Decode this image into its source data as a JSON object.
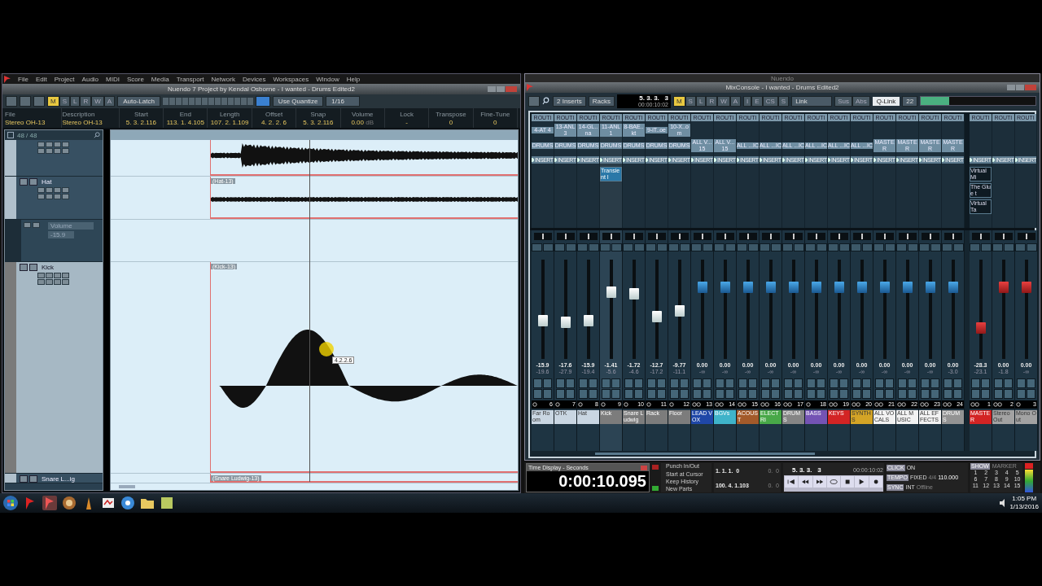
{
  "left_window": {
    "menu": [
      "File",
      "Edit",
      "Project",
      "Audio",
      "MIDI",
      "Score",
      "Media",
      "Transport",
      "Network",
      "Devices",
      "Workspaces",
      "Window",
      "Help"
    ],
    "title": "Nuendo 7 Project by Kendal Osborne - I wanted - Drums Edited2",
    "toolbar": {
      "modes": [
        {
          "label": "M",
          "on": true
        },
        {
          "label": "S",
          "on": false
        },
        {
          "label": "L",
          "on": false
        },
        {
          "label": "R",
          "on": false
        },
        {
          "label": "W",
          "on": false
        },
        {
          "label": "A",
          "on": false
        }
      ],
      "automation_mode": "Auto-Latch",
      "quantize": "Use Quantize",
      "grid": "1/16"
    },
    "info_line": [
      {
        "label": "File",
        "value": "Stereo OH-13"
      },
      {
        "label": "Description",
        "value": "Stereo OH-13"
      },
      {
        "label": "Start",
        "value": "5. 3. 2.116"
      },
      {
        "label": "End",
        "value": "113. 1. 4.105"
      },
      {
        "label": "Length",
        "value": "107. 2. 1.109"
      },
      {
        "label": "Offset",
        "value": "4. 2. 2.  6"
      },
      {
        "label": "Snap",
        "value": "5. 3. 2.116"
      },
      {
        "label": "Volume",
        "value": "0.00",
        "unit": "dB"
      },
      {
        "label": "Lock",
        "value": "-"
      },
      {
        "label": "Transpose",
        "value": "0"
      },
      {
        "label": "Fine-Tune",
        "value": "0"
      }
    ],
    "track_count": "48 / 48",
    "tracks": [
      {
        "kind": "track",
        "selected": false
      },
      {
        "kind": "track",
        "name": "Hat",
        "selected": false,
        "event": "(Hat-13)"
      },
      {
        "kind": "automation",
        "parameter": "Volume",
        "value": "-15.9"
      },
      {
        "kind": "track",
        "name": "Kick",
        "selected": true,
        "event": "(Kick-13)"
      },
      {
        "kind": "track",
        "name": "Snare L...ig",
        "selected": false,
        "event": "(Snare Ludwig-13)"
      }
    ],
    "tooltip": "4.2.2.6"
  },
  "mixer": {
    "app_title": "Nuendo",
    "title": "MixConsole - I wanted - Drums Edited2",
    "toolbar": {
      "inserts": "2 Inserts",
      "racks": "Racks",
      "position": "5. 3. 3.   3",
      "time": "00:00:10:02",
      "modes": [
        {
          "label": "M",
          "on": true
        },
        {
          "label": "S",
          "on": false
        },
        {
          "label": "L",
          "on": false
        },
        {
          "label": "R",
          "on": false
        },
        {
          "label": "W",
          "on": false
        },
        {
          "label": "A",
          "on": false
        }
      ],
      "views": [
        "I",
        "E",
        "CS",
        "S"
      ],
      "link": "Link",
      "sus": "Sus",
      "abs": "Abs",
      "qlink": "Q-Link",
      "zoom": "22",
      "level": 0.25
    },
    "channels": [
      {
        "kind": "audio",
        "number": "6",
        "name": "Far Room",
        "color": "#c9d6e2",
        "stereo": false,
        "selected": false,
        "level": 0.37,
        "reading": "-15.9",
        "peak": "-19.6",
        "routing": "ROUTI",
        "input": "4-AT 4",
        "output": "DRUMS",
        "insert_header": "INSERT"
      },
      {
        "kind": "audio",
        "number": "7",
        "name": "OTK",
        "color": "#c9d6e2",
        "stereo": false,
        "selected": false,
        "level": 0.35,
        "reading": "-17.6",
        "peak": "-27.9",
        "routing": "ROUTI",
        "input": "13-ANL 3",
        "output": "DRUMS",
        "insert_header": "INSERT"
      },
      {
        "kind": "audio",
        "number": "8",
        "name": "Hat",
        "color": "#c9d6e2",
        "stereo": false,
        "selected": false,
        "level": 0.37,
        "reading": "-15.9",
        "peak": "-19.4",
        "routing": "ROUTI",
        "input": "14-GL..na",
        "output": "DRUMS",
        "insert_header": "INSERT"
      },
      {
        "kind": "audio",
        "number": "9",
        "name": "Kick",
        "color": "#7c7c7c",
        "stereo": false,
        "selected": true,
        "level": 0.69,
        "reading": "-1.41",
        "peak": "-5.6",
        "routing": "ROUTI",
        "input": "11-ANL 1",
        "output": "DRUMS",
        "insert_header": "INSERT",
        "insert": "Transient I"
      },
      {
        "kind": "audio",
        "number": "10",
        "name": "Snare Ludwig",
        "color": "#7c7c7c",
        "stereo": false,
        "selected": false,
        "level": 0.68,
        "reading": "-1.72",
        "peak": "-4.6",
        "routing": "ROUTI",
        "input": "8-BAE..kt",
        "output": "DRUMS",
        "insert_header": "INSERT"
      },
      {
        "kind": "audio",
        "number": "11",
        "name": "Rack",
        "color": "#7c7c7c",
        "stereo": false,
        "selected": false,
        "level": 0.42,
        "reading": "-12.7",
        "peak": "-17.2",
        "routing": "ROUTI",
        "input": "9-iT..oe",
        "output": "DRUMS",
        "insert_header": "INSERT"
      },
      {
        "kind": "audio",
        "number": "12",
        "name": "Floor",
        "color": "#7c7c7c",
        "stereo": false,
        "selected": false,
        "level": 0.48,
        "reading": "-9.77",
        "peak": "-11.1",
        "routing": "ROUTI",
        "input": "10-X..om",
        "output": "DRUMS",
        "insert_header": "INSERT"
      },
      {
        "kind": "group",
        "number": "13",
        "name": "LEAD VOX",
        "color": "#1f47a8",
        "stereo": true,
        "selected": false,
        "level": 0.75,
        "reading": "0.00",
        "peak": "-∞",
        "routing": "ROUTI",
        "output": "ALL V...15",
        "insert_header": "INSERT"
      },
      {
        "kind": "group",
        "number": "14",
        "name": "BGVs",
        "color": "#3fb3c9",
        "stereo": true,
        "selected": false,
        "level": 0.75,
        "reading": "0.00",
        "peak": "-∞",
        "routing": "ROUTI",
        "output": "ALL V...15",
        "insert_header": "INSERT"
      },
      {
        "kind": "group",
        "number": "15",
        "name": "ACOUST",
        "color": "#a35a2a",
        "stereo": true,
        "selected": false,
        "level": 0.75,
        "reading": "0.00",
        "peak": "-∞",
        "routing": "ROUTI",
        "output": "ALL ...IC",
        "insert_header": "INSERT"
      },
      {
        "kind": "group",
        "number": "16",
        "name": "ELECTRI",
        "color": "#48a848",
        "stereo": true,
        "selected": false,
        "level": 0.75,
        "reading": "0.00",
        "peak": "-∞",
        "routing": "ROUTI",
        "output": "ALL ...IC",
        "insert_header": "INSERT"
      },
      {
        "kind": "group",
        "number": "17",
        "name": "DRUMS",
        "color": "#858585",
        "stereo": true,
        "selected": false,
        "level": 0.75,
        "reading": "0.00",
        "peak": "-∞",
        "routing": "ROUTI",
        "output": "ALL ...IC",
        "insert_header": "INSERT"
      },
      {
        "kind": "group",
        "number": "18",
        "name": "BASS",
        "color": "#7453b4",
        "stereo": false,
        "selected": false,
        "level": 0.75,
        "reading": "0.00",
        "peak": "-∞",
        "routing": "ROUTI",
        "output": "ALL ...IC",
        "insert_header": "INSERT"
      },
      {
        "kind": "group",
        "number": "19",
        "name": "KEYS",
        "color": "#d32424",
        "stereo": true,
        "selected": false,
        "level": 0.75,
        "reading": "0.00",
        "peak": "-∞",
        "routing": "ROUTI",
        "output": "ALL ...IC",
        "insert_header": "INSERT"
      },
      {
        "kind": "group",
        "number": "20",
        "name": "SYNTHS",
        "color": "#d4a426",
        "stereo": true,
        "selected": false,
        "level": 0.75,
        "reading": "0.00",
        "peak": "-∞",
        "routing": "ROUTI",
        "output": "ALL ...IC",
        "insert_header": "INSERT"
      },
      {
        "kind": "group",
        "number": "21",
        "name": "ALL VOCALS",
        "color": "#f2f2f2",
        "stereo": true,
        "selected": false,
        "level": 0.75,
        "reading": "0.00",
        "peak": "-∞",
        "routing": "ROUTI",
        "output": "MASTER",
        "insert_header": "INSERT"
      },
      {
        "kind": "group",
        "number": "22",
        "name": "ALL MUSIC",
        "color": "#f2f2f2",
        "stereo": true,
        "selected": false,
        "level": 0.75,
        "reading": "0.00",
        "peak": "-∞",
        "routing": "ROUTI",
        "output": "MASTER",
        "insert_header": "INSERT"
      },
      {
        "kind": "group",
        "number": "23",
        "name": "ALL EFFECTS",
        "color": "#f2f2f2",
        "stereo": true,
        "selected": false,
        "level": 0.75,
        "reading": "0.00",
        "peak": "-∞",
        "routing": "ROUTI",
        "output": "MASTER",
        "insert_header": "INSERT"
      },
      {
        "kind": "group",
        "number": "24",
        "name": "DRUMS",
        "color": "#939393",
        "stereo": true,
        "selected": false,
        "level": 0.75,
        "reading": "0.00",
        "peak": "-3.0",
        "routing": "ROUTI",
        "output": "MASTER",
        "insert_header": "INSERT"
      },
      {
        "kind": "output",
        "number": "1",
        "name": "MASTER",
        "color": "#d32424",
        "stereo": true,
        "selected": false,
        "level": 0.29,
        "reading": "-28.3",
        "peak": "-23.1",
        "routing": "ROUTI",
        "insert_header": "INSERT",
        "inserts": [
          "Virtual Mi",
          "The Glue t",
          "Virtual Ta"
        ]
      },
      {
        "kind": "output",
        "number": "2",
        "name": "Stereo Out",
        "color": "#a2a2a2",
        "stereo": true,
        "selected": false,
        "level": 0.75,
        "reading": "0.00",
        "peak": "-1.8",
        "routing": "ROUTI",
        "insert_header": "INSERT"
      },
      {
        "kind": "output",
        "number": "3",
        "name": "Mono Out",
        "color": "#a2a2a2",
        "stereo": false,
        "selected": false,
        "level": 0.75,
        "reading": "0.00",
        "peak": "-∞",
        "routing": "ROUTI",
        "insert_header": "INSERT"
      }
    ]
  },
  "transport": {
    "time_title": "Time Display - Seconds",
    "time": "0:00:10.095",
    "options": [
      "Punch In/Out",
      "Start at Cursor",
      "Keep History",
      "New Parts"
    ],
    "left_locator": "1. 1. 1.  0",
    "left_offset": "0.  0",
    "right_locator": "100. 4. 1.103",
    "right_offset": "0.  0",
    "position": "5. 3. 3.   3",
    "time_code": "00:00:10:02",
    "settings": [
      {
        "label": "CLICK",
        "value": "ON"
      },
      {
        "label": "TEMPO",
        "value": "FIXED",
        "extra": "4/4",
        "sub": "110.000"
      },
      {
        "label": "SYNC",
        "value": "INT",
        "extra": "Offline"
      }
    ],
    "marker_show": "SHOW",
    "marker_title": "MARKER",
    "markers": [
      "1",
      "2",
      "3",
      "4",
      "5",
      "6",
      "7",
      "8",
      "9",
      "10",
      "11",
      "12",
      "13",
      "14",
      "15"
    ]
  },
  "taskbar": {
    "time": "1:05 PM",
    "date": "1/13/2016"
  }
}
